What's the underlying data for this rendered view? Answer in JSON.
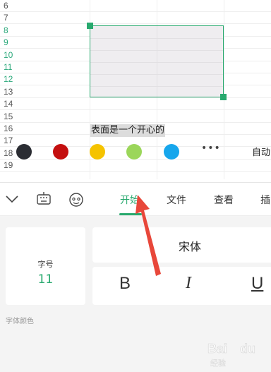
{
  "sheet": {
    "rows": [
      {
        "num": "6",
        "selected": false
      },
      {
        "num": "7",
        "selected": false
      },
      {
        "num": "8",
        "selected": true
      },
      {
        "num": "9",
        "selected": true
      },
      {
        "num": "10",
        "selected": true
      },
      {
        "num": "11",
        "selected": true
      },
      {
        "num": "12",
        "selected": true
      },
      {
        "num": "13",
        "selected": false
      },
      {
        "num": "14",
        "selected": false
      },
      {
        "num": "15",
        "selected": false
      },
      {
        "num": "16",
        "selected": false
      },
      {
        "num": "17",
        "selected": false
      },
      {
        "num": "18",
        "selected": false
      },
      {
        "num": "19",
        "selected": false
      }
    ],
    "cell_text": "表面是一个开心的"
  },
  "toolbar": {
    "collapse_icon": "chevron-down-icon",
    "keyboard_icon": "keyboard-icon",
    "emoji_icon": "emoji-icon",
    "tabs": [
      {
        "label": "开始",
        "active": true
      },
      {
        "label": "文件",
        "active": false
      },
      {
        "label": "查看",
        "active": false
      },
      {
        "label": "插",
        "active": false
      }
    ]
  },
  "format_panel": {
    "font_size_label": "字号",
    "font_size_value": "11",
    "font_name": "宋体",
    "bold_label": "B",
    "italic_label": "I",
    "underline_label": "U",
    "font_color_label": "字体颜色",
    "color_swatches": [
      "#2b2d33",
      "#c40f0f",
      "#f5c300",
      "#9bd65a",
      "#16a6ec"
    ],
    "more_label": "•••",
    "auto_label": "自动"
  },
  "colors": {
    "accent": "#28a96e",
    "annotation_arrow": "#e8473a"
  },
  "watermark": "Bai du 经验"
}
